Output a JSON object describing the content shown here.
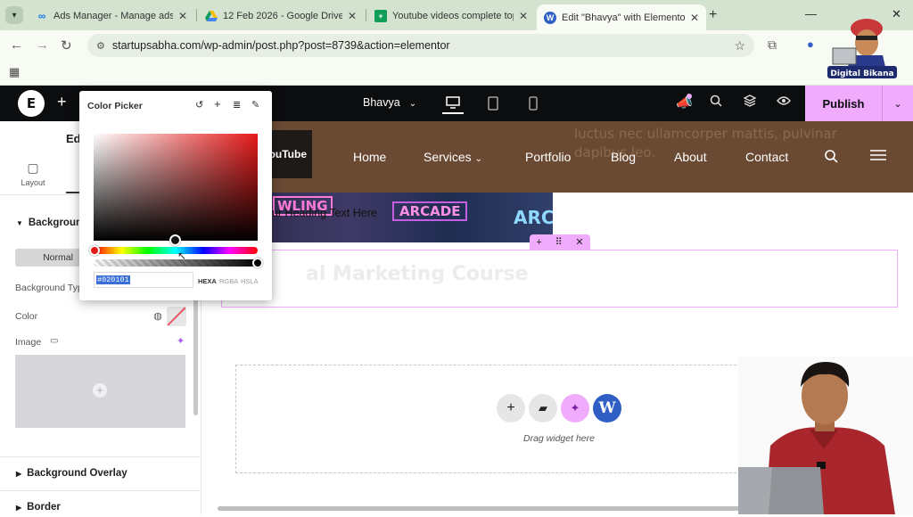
{
  "browser": {
    "tabs": [
      {
        "label": "Ads Manager - Manage ads - C",
        "favicon": "meta-icon",
        "active": false
      },
      {
        "label": "12 Feb 2026 - Google Drive",
        "favicon": "drive-icon",
        "active": false
      },
      {
        "label": "Youtube videos complete topic",
        "favicon": "sheets-icon",
        "active": false
      },
      {
        "label": "Edit \"Bhavya\" with Elementor",
        "favicon": "wordpress-icon",
        "active": true
      }
    ],
    "url": "startupsabha.com/wp-admin/post.php?post=8739&action=elementor"
  },
  "watermark": {
    "text": "Digital Bikana"
  },
  "elementor_top": {
    "site_name": "Bhavya",
    "publish_label": "Publish"
  },
  "left_panel": {
    "title": "Edi",
    "tab_layout": "Layout",
    "section_background": "Background",
    "normal_label": "Normal",
    "background_type_label": "Background Type",
    "color_label": "Color",
    "image_label": "Image",
    "section_background_overlay": "Background Overlay",
    "section_border": "Border"
  },
  "color_picker": {
    "title": "Color Picker",
    "hex_value": "#020101",
    "formats": [
      "HEXA",
      "RGBA",
      "HSLA"
    ],
    "active_format": "HEXA",
    "hue_color": "#e51a1a",
    "alpha": 1.0
  },
  "canvas": {
    "hero_text_line1": "luctus nec ullamcorper mattis, pulvinar",
    "hero_text_line2": "dapibus leo.",
    "logo_text": "ouTube",
    "nav": [
      "Home",
      "Services",
      "Portfolio",
      "Blog",
      "About",
      "Contact"
    ],
    "neon_signs": [
      "WLING",
      "ARCADE",
      "ARC"
    ],
    "heading_text": "our Heading Text Here",
    "course_title": "al Marketing Course",
    "drag_text": "Drag widget here"
  },
  "colors": {
    "elementor_dark": "#0c0d0e",
    "publish_pink": "#f0abfc",
    "hero_brown": "#6b4a33",
    "wp_blue": "#2f5fc4"
  }
}
